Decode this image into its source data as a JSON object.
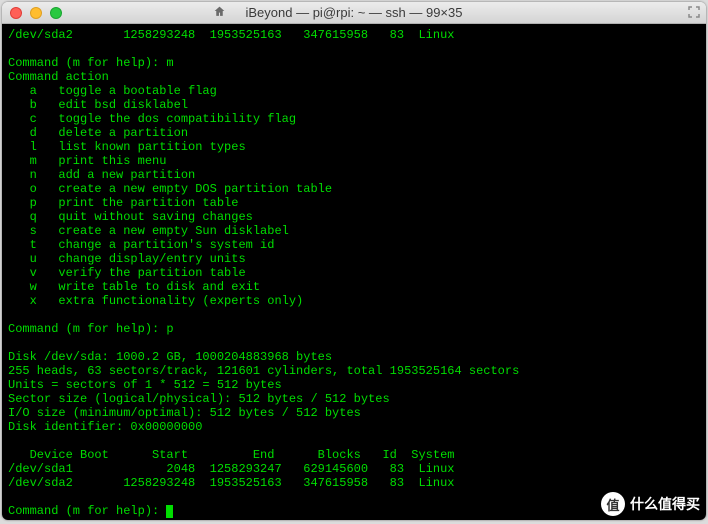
{
  "title": "iBeyond — pi@rpi: ~ — ssh — 99×35",
  "colors": {
    "terminal_bg": "#000000",
    "terminal_fg": "#00dd00"
  },
  "partition_row_top": {
    "device": "/dev/sda2",
    "start": "1258293248",
    "end": "1953525163",
    "blocks": "347615958",
    "id": "83",
    "system": "Linux"
  },
  "prompt_m": "Command (m for help): m",
  "command_action_header": "Command action",
  "actions": [
    {
      "key": "a",
      "desc": "toggle a bootable flag"
    },
    {
      "key": "b",
      "desc": "edit bsd disklabel"
    },
    {
      "key": "c",
      "desc": "toggle the dos compatibility flag"
    },
    {
      "key": "d",
      "desc": "delete a partition"
    },
    {
      "key": "l",
      "desc": "list known partition types"
    },
    {
      "key": "m",
      "desc": "print this menu"
    },
    {
      "key": "n",
      "desc": "add a new partition"
    },
    {
      "key": "o",
      "desc": "create a new empty DOS partition table"
    },
    {
      "key": "p",
      "desc": "print the partition table"
    },
    {
      "key": "q",
      "desc": "quit without saving changes"
    },
    {
      "key": "s",
      "desc": "create a new empty Sun disklabel"
    },
    {
      "key": "t",
      "desc": "change a partition's system id"
    },
    {
      "key": "u",
      "desc": "change display/entry units"
    },
    {
      "key": "v",
      "desc": "verify the partition table"
    },
    {
      "key": "w",
      "desc": "write table to disk and exit"
    },
    {
      "key": "x",
      "desc": "extra functionality (experts only)"
    }
  ],
  "prompt_p": "Command (m for help): p",
  "disk_info": {
    "line1": "Disk /dev/sda: 1000.2 GB, 1000204883968 bytes",
    "line2": "255 heads, 63 sectors/track, 121601 cylinders, total 1953525164 sectors",
    "line3": "Units = sectors of 1 * 512 = 512 bytes",
    "line4": "Sector size (logical/physical): 512 bytes / 512 bytes",
    "line5": "I/O size (minimum/optimal): 512 bytes / 512 bytes",
    "line6": "Disk identifier: 0x00000000"
  },
  "table_header": {
    "device": "Device",
    "boot": "Boot",
    "start": "Start",
    "end": "End",
    "blocks": "Blocks",
    "id": "Id",
    "system": "System"
  },
  "partitions": [
    {
      "device": "/dev/sda1",
      "start": "2048",
      "end": "1258293247",
      "blocks": "629145600",
      "id": "83",
      "system": "Linux"
    },
    {
      "device": "/dev/sda2",
      "start": "1258293248",
      "end": "1953525163",
      "blocks": "347615958",
      "id": "83",
      "system": "Linux"
    }
  ],
  "prompt_final": "Command (m for help): ",
  "watermark": {
    "badge": "值",
    "text": "什么值得买"
  }
}
